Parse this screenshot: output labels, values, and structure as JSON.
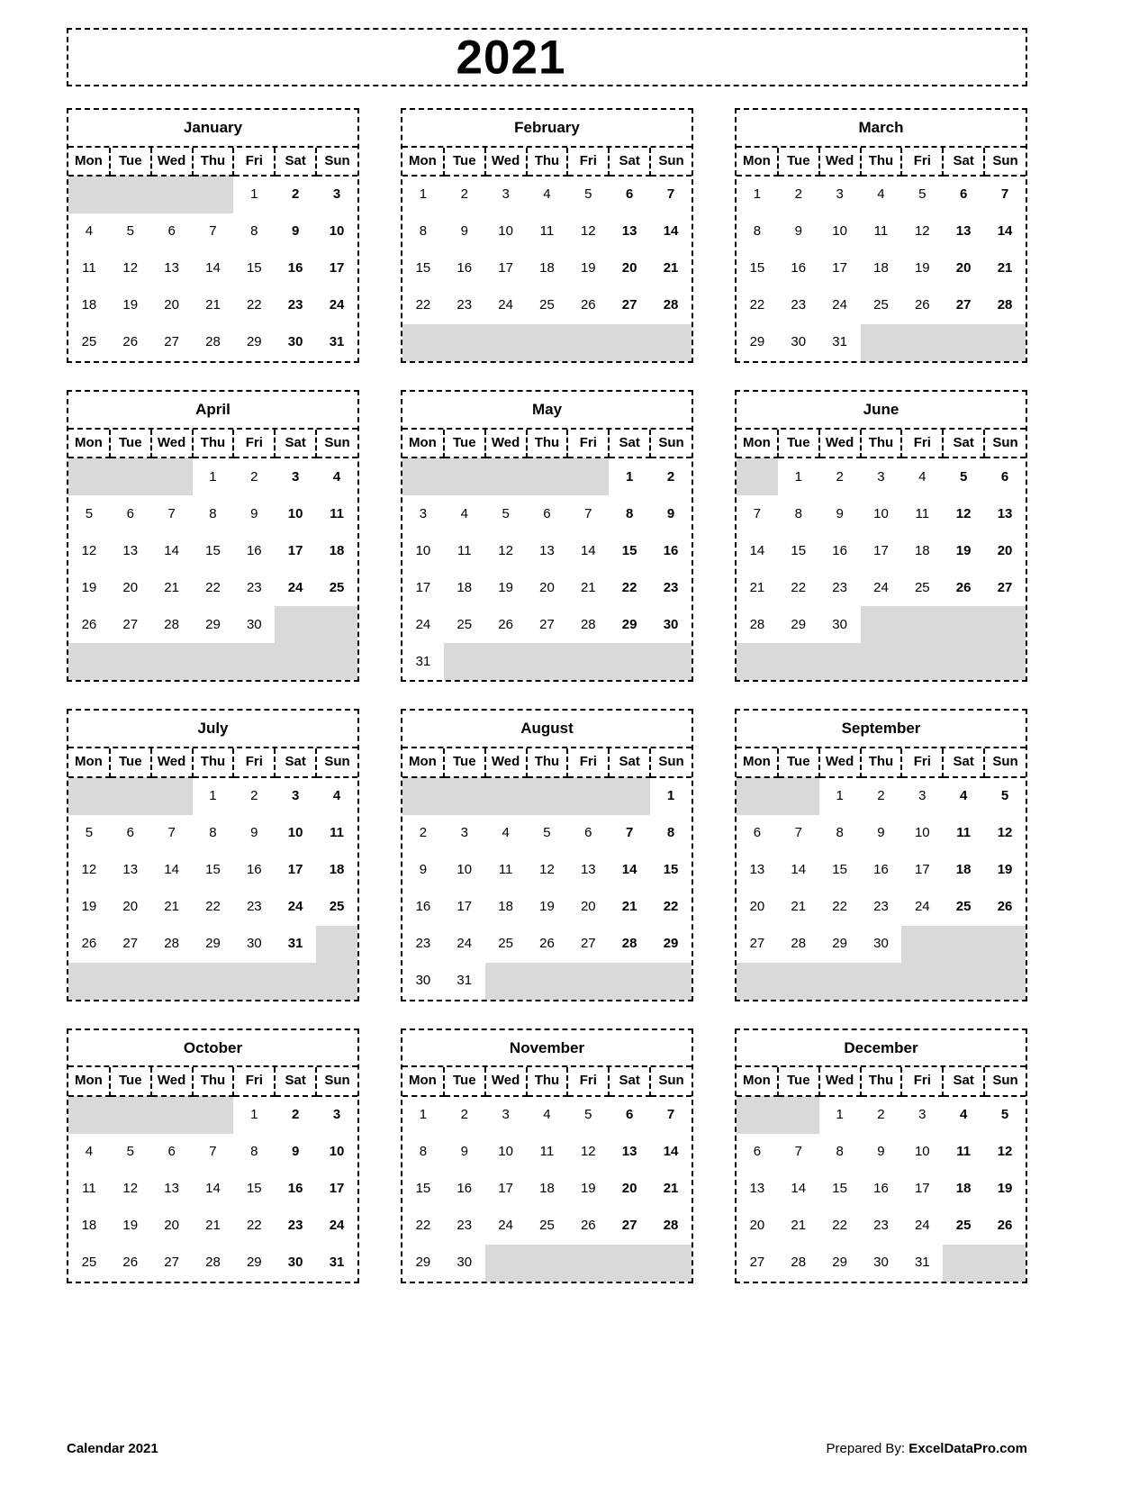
{
  "title": "2021",
  "weekday_headers": [
    "Mon",
    "Tue",
    "Wed",
    "Thu",
    "Fri",
    "Sat",
    "Sun"
  ],
  "colors": {
    "blank_cell": "#d9d9d9",
    "border": "#000000",
    "text": "#000000",
    "background": "#ffffff"
  },
  "footer": {
    "left": "Calendar 2021",
    "right_prefix": "Prepared By: ",
    "right_brand": "ExcelDataPro.com"
  },
  "months": [
    {
      "name": "January",
      "weeks": [
        [
          null,
          null,
          null,
          null,
          "1",
          "2",
          "3"
        ],
        [
          "4",
          "5",
          "6",
          "7",
          "8",
          "9",
          "10"
        ],
        [
          "11",
          "12",
          "13",
          "14",
          "15",
          "16",
          "17"
        ],
        [
          "18",
          "19",
          "20",
          "21",
          "22",
          "23",
          "24"
        ],
        [
          "25",
          "26",
          "27",
          "28",
          "29",
          "30",
          "31"
        ]
      ]
    },
    {
      "name": "February",
      "weeks": [
        [
          "1",
          "2",
          "3",
          "4",
          "5",
          "6",
          "7"
        ],
        [
          "8",
          "9",
          "10",
          "11",
          "12",
          "13",
          "14"
        ],
        [
          "15",
          "16",
          "17",
          "18",
          "19",
          "20",
          "21"
        ],
        [
          "22",
          "23",
          "24",
          "25",
          "26",
          "27",
          "28"
        ],
        [
          null,
          null,
          null,
          null,
          null,
          null,
          null
        ]
      ]
    },
    {
      "name": "March",
      "weeks": [
        [
          "1",
          "2",
          "3",
          "4",
          "5",
          "6",
          "7"
        ],
        [
          "8",
          "9",
          "10",
          "11",
          "12",
          "13",
          "14"
        ],
        [
          "15",
          "16",
          "17",
          "18",
          "19",
          "20",
          "21"
        ],
        [
          "22",
          "23",
          "24",
          "25",
          "26",
          "27",
          "28"
        ],
        [
          "29",
          "30",
          "31",
          null,
          null,
          null,
          null
        ]
      ]
    },
    {
      "name": "April",
      "weeks": [
        [
          null,
          null,
          null,
          "1",
          "2",
          "3",
          "4"
        ],
        [
          "5",
          "6",
          "7",
          "8",
          "9",
          "10",
          "11"
        ],
        [
          "12",
          "13",
          "14",
          "15",
          "16",
          "17",
          "18"
        ],
        [
          "19",
          "20",
          "21",
          "22",
          "23",
          "24",
          "25"
        ],
        [
          "26",
          "27",
          "28",
          "29",
          "30",
          null,
          null
        ],
        [
          null,
          null,
          null,
          null,
          null,
          null,
          null
        ]
      ]
    },
    {
      "name": "May",
      "weeks": [
        [
          null,
          null,
          null,
          null,
          null,
          "1",
          "2"
        ],
        [
          "3",
          "4",
          "5",
          "6",
          "7",
          "8",
          "9"
        ],
        [
          "10",
          "11",
          "12",
          "13",
          "14",
          "15",
          "16"
        ],
        [
          "17",
          "18",
          "19",
          "20",
          "21",
          "22",
          "23"
        ],
        [
          "24",
          "25",
          "26",
          "27",
          "28",
          "29",
          "30"
        ],
        [
          "31",
          null,
          null,
          null,
          null,
          null,
          null
        ]
      ]
    },
    {
      "name": "June",
      "weeks": [
        [
          null,
          "1",
          "2",
          "3",
          "4",
          "5",
          "6"
        ],
        [
          "7",
          "8",
          "9",
          "10",
          "11",
          "12",
          "13"
        ],
        [
          "14",
          "15",
          "16",
          "17",
          "18",
          "19",
          "20"
        ],
        [
          "21",
          "22",
          "23",
          "24",
          "25",
          "26",
          "27"
        ],
        [
          "28",
          "29",
          "30",
          null,
          null,
          null,
          null
        ],
        [
          null,
          null,
          null,
          null,
          null,
          null,
          null
        ]
      ]
    },
    {
      "name": "July",
      "weeks": [
        [
          null,
          null,
          null,
          "1",
          "2",
          "3",
          "4"
        ],
        [
          "5",
          "6",
          "7",
          "8",
          "9",
          "10",
          "11"
        ],
        [
          "12",
          "13",
          "14",
          "15",
          "16",
          "17",
          "18"
        ],
        [
          "19",
          "20",
          "21",
          "22",
          "23",
          "24",
          "25"
        ],
        [
          "26",
          "27",
          "28",
          "29",
          "30",
          "31",
          null
        ],
        [
          null,
          null,
          null,
          null,
          null,
          null,
          null
        ]
      ]
    },
    {
      "name": "August",
      "weeks": [
        [
          null,
          null,
          null,
          null,
          null,
          null,
          "1"
        ],
        [
          "2",
          "3",
          "4",
          "5",
          "6",
          "7",
          "8"
        ],
        [
          "9",
          "10",
          "11",
          "12",
          "13",
          "14",
          "15"
        ],
        [
          "16",
          "17",
          "18",
          "19",
          "20",
          "21",
          "22"
        ],
        [
          "23",
          "24",
          "25",
          "26",
          "27",
          "28",
          "29"
        ],
        [
          "30",
          "31",
          null,
          null,
          null,
          null,
          null
        ]
      ]
    },
    {
      "name": "September",
      "weeks": [
        [
          null,
          null,
          "1",
          "2",
          "3",
          "4",
          "5"
        ],
        [
          "6",
          "7",
          "8",
          "9",
          "10",
          "11",
          "12"
        ],
        [
          "13",
          "14",
          "15",
          "16",
          "17",
          "18",
          "19"
        ],
        [
          "20",
          "21",
          "22",
          "23",
          "24",
          "25",
          "26"
        ],
        [
          "27",
          "28",
          "29",
          "30",
          null,
          null,
          null
        ],
        [
          null,
          null,
          null,
          null,
          null,
          null,
          null
        ]
      ]
    },
    {
      "name": "October",
      "weeks": [
        [
          null,
          null,
          null,
          null,
          "1",
          "2",
          "3"
        ],
        [
          "4",
          "5",
          "6",
          "7",
          "8",
          "9",
          "10"
        ],
        [
          "11",
          "12",
          "13",
          "14",
          "15",
          "16",
          "17"
        ],
        [
          "18",
          "19",
          "20",
          "21",
          "22",
          "23",
          "24"
        ],
        [
          "25",
          "26",
          "27",
          "28",
          "29",
          "30",
          "31"
        ]
      ]
    },
    {
      "name": "November",
      "weeks": [
        [
          "1",
          "2",
          "3",
          "4",
          "5",
          "6",
          "7"
        ],
        [
          "8",
          "9",
          "10",
          "11",
          "12",
          "13",
          "14"
        ],
        [
          "15",
          "16",
          "17",
          "18",
          "19",
          "20",
          "21"
        ],
        [
          "22",
          "23",
          "24",
          "25",
          "26",
          "27",
          "28"
        ],
        [
          "29",
          "30",
          null,
          null,
          null,
          null,
          null
        ]
      ]
    },
    {
      "name": "December",
      "weeks": [
        [
          null,
          null,
          "1",
          "2",
          "3",
          "4",
          "5"
        ],
        [
          "6",
          "7",
          "8",
          "9",
          "10",
          "11",
          "12"
        ],
        [
          "13",
          "14",
          "15",
          "16",
          "17",
          "18",
          "19"
        ],
        [
          "20",
          "21",
          "22",
          "23",
          "24",
          "25",
          "26"
        ],
        [
          "27",
          "28",
          "29",
          "30",
          "31",
          null,
          null
        ]
      ]
    }
  ]
}
